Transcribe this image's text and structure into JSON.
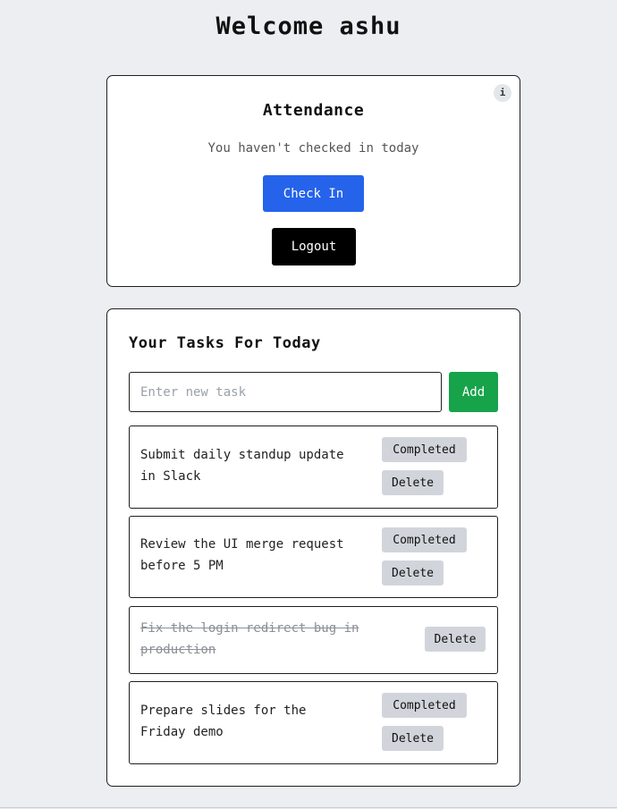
{
  "header": {
    "title": "Welcome ashu"
  },
  "attendance": {
    "info_label": "i",
    "title": "Attendance",
    "status": "You haven't checked in today",
    "checkin_label": "Check In",
    "logout_label": "Logout"
  },
  "tasks": {
    "title": "Your Tasks For Today",
    "input_placeholder": "Enter new task",
    "input_value": "",
    "add_label": "Add",
    "completed_label": "Completed",
    "delete_label": "Delete",
    "items": [
      {
        "text": "Submit daily standup update in Slack",
        "completed": false
      },
      {
        "text": "Review the UI merge request before 5 PM",
        "completed": false
      },
      {
        "text": "Fix the login redirect bug in production",
        "completed": true
      },
      {
        "text": "Prepare slides for the Friday demo",
        "completed": false
      }
    ]
  },
  "colors": {
    "background": "#eceef2",
    "primary": "#2563eb",
    "success": "#16a34a",
    "dark": "#000000",
    "muted_button": "#d1d5db"
  }
}
